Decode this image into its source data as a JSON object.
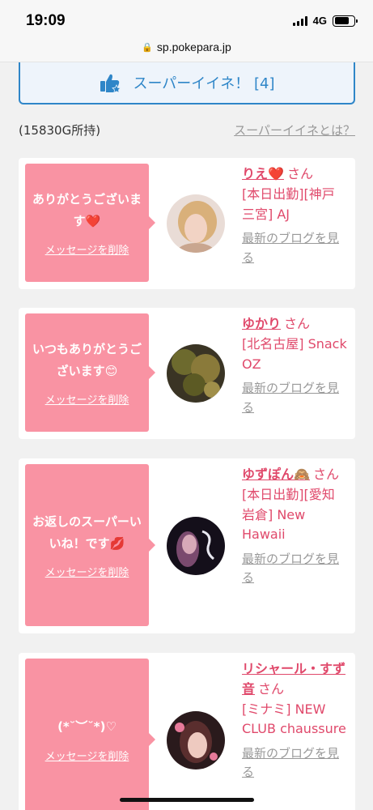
{
  "status": {
    "time": "19:09",
    "network": "4G"
  },
  "url": "sp.pokepara.jp",
  "super_iine": {
    "label": "スーパーイイネ！ [4]"
  },
  "holdings": "(15830G所持)",
  "about_link": "スーパーイイネとは？",
  "blog_link": "最新のブログを見る",
  "delete_label": "メッセージを削除",
  "suffix": "さん",
  "colors": {
    "accent_pink": "#f993a3",
    "name_pink": "#e0496b",
    "blue": "#2f86c8"
  },
  "cards": [
    {
      "message": "ありがとうございます",
      "emoji": "❤️",
      "name": "りえ",
      "name_emoji": "❤️",
      "shop": "[本日出勤][神戸三宮] AJ"
    },
    {
      "message": "いつもありがとうございます",
      "emoji": "😊",
      "name": "ゆかり",
      "name_emoji": "",
      "shop": "[北名古屋] Snack OZ"
    },
    {
      "message": "お返しのスーパーいいね！です",
      "emoji": "💋",
      "name": "ゆずぽん",
      "name_emoji": "🙈",
      "shop": "[本日出勤][愛知 岩倉] New Hawaii"
    },
    {
      "message": "(*˘︶˘*)♡",
      "emoji": "",
      "name": "リシャール・すず音",
      "name_emoji": "",
      "shop": "[ミナミ] NEW CLUB chaussure"
    }
  ]
}
